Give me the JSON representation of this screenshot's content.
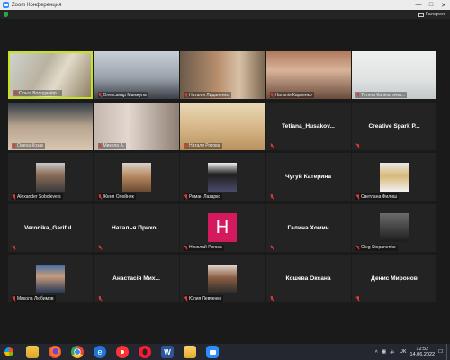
{
  "window": {
    "title": "Zoom Конференция",
    "icon": "zoom-icon"
  },
  "meeting_bar": {
    "view_label": "Галерея"
  },
  "participants": [
    {
      "name": "Ольга Володимир...",
      "type": "video",
      "active": true
    },
    {
      "name": "Олександр Манжула",
      "type": "video"
    },
    {
      "name": "Наталія Лиданенко",
      "type": "video"
    },
    {
      "name": "Наталія Карпенко",
      "type": "video"
    },
    {
      "name": "Тетяна Каліна, вчит...",
      "type": "video"
    },
    {
      "name": "Олена Козак",
      "type": "video"
    },
    {
      "name": "Микола А.",
      "type": "video"
    },
    {
      "name": "Наталя Ротова",
      "type": "video"
    },
    {
      "name": "Tetiana_Husakov...",
      "type": "name"
    },
    {
      "name": "Creative Spark P...",
      "type": "name"
    },
    {
      "name": "Alexander Sobolevets",
      "type": "photo"
    },
    {
      "name": "Женя Олейник",
      "type": "photo"
    },
    {
      "name": "Роман Лазарко",
      "type": "photo"
    },
    {
      "name": "Чугуй Катерина",
      "type": "name"
    },
    {
      "name": "Светлана Филиш",
      "type": "photo"
    },
    {
      "name": "Veronika_Gariful...",
      "type": "name"
    },
    {
      "name": "Наталья Прихо...",
      "type": "name"
    },
    {
      "name": "Николай Рогоза",
      "type": "letter",
      "letter": "H"
    },
    {
      "name": "Галина Хомич",
      "type": "name"
    },
    {
      "name": "Oleg Stepanenko",
      "type": "photo"
    },
    {
      "name": "Микола Любимов",
      "type": "photo"
    },
    {
      "name": "Анастасія Мих...",
      "type": "name"
    },
    {
      "name": "Юлия Левченко",
      "type": "photo"
    },
    {
      "name": "Кошева Оксана",
      "type": "name"
    },
    {
      "name": "Денис Миронов",
      "type": "name"
    }
  ],
  "taskbar": {
    "apps": [
      "file-explorer-icon",
      "firefox-icon",
      "chrome-icon",
      "edge-icon",
      "yandex-icon",
      "opera-icon",
      "word-icon",
      "folder-icon",
      "zoom-icon"
    ],
    "tray": {
      "language": "UK",
      "time": "12:52",
      "date": "14.06.2022"
    }
  },
  "colors": {
    "active_speaker_border": "#c8e21d",
    "avatar_letter_bg": "#d31a5e",
    "muted_icon": "#e03a3a",
    "zoom_blue": "#2d8cff"
  }
}
